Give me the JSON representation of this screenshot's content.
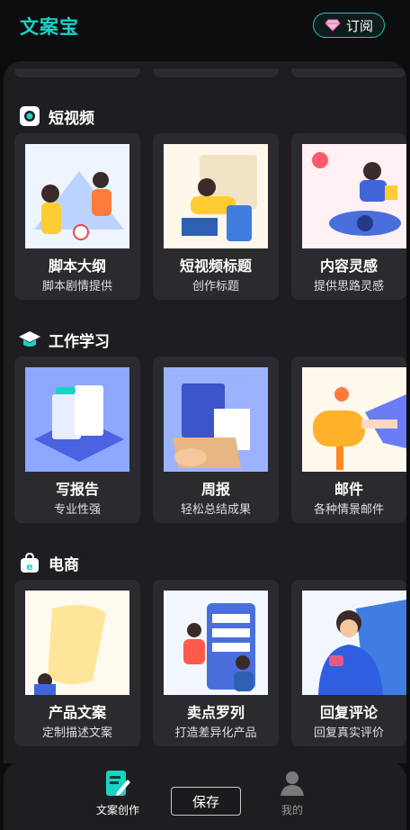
{
  "app": {
    "brand": "文案宝",
    "subscribe_label": "订阅"
  },
  "sections": [
    {
      "title": "短视频",
      "icon": "camera-icon",
      "cards": [
        {
          "title": "脚本大纲",
          "sub": "脚本剧情提供"
        },
        {
          "title": "短视频标题",
          "sub": "创作标题"
        },
        {
          "title": "内容灵感",
          "sub": "提供思路灵感"
        }
      ]
    },
    {
      "title": "工作学习",
      "icon": "graduation-cap-icon",
      "cards": [
        {
          "title": "写报告",
          "sub": "专业性强"
        },
        {
          "title": "周报",
          "sub": "轻松总结成果"
        },
        {
          "title": "邮件",
          "sub": "各种情景邮件"
        }
      ]
    },
    {
      "title": "电商",
      "icon": "shopping-bag-icon",
      "cards": [
        {
          "title": "产品文案",
          "sub": "定制描述文案"
        },
        {
          "title": "卖点罗列",
          "sub": "打造差异化产品"
        },
        {
          "title": "回复评论",
          "sub": "回复真实评价"
        }
      ]
    }
  ],
  "tabbar": {
    "create_label": "文案创作",
    "save_label": "保存",
    "mine_label": "我的"
  },
  "colors": {
    "accent": "#19d3c5",
    "panel": "#1e1e22",
    "card": "#2a2a2f"
  }
}
